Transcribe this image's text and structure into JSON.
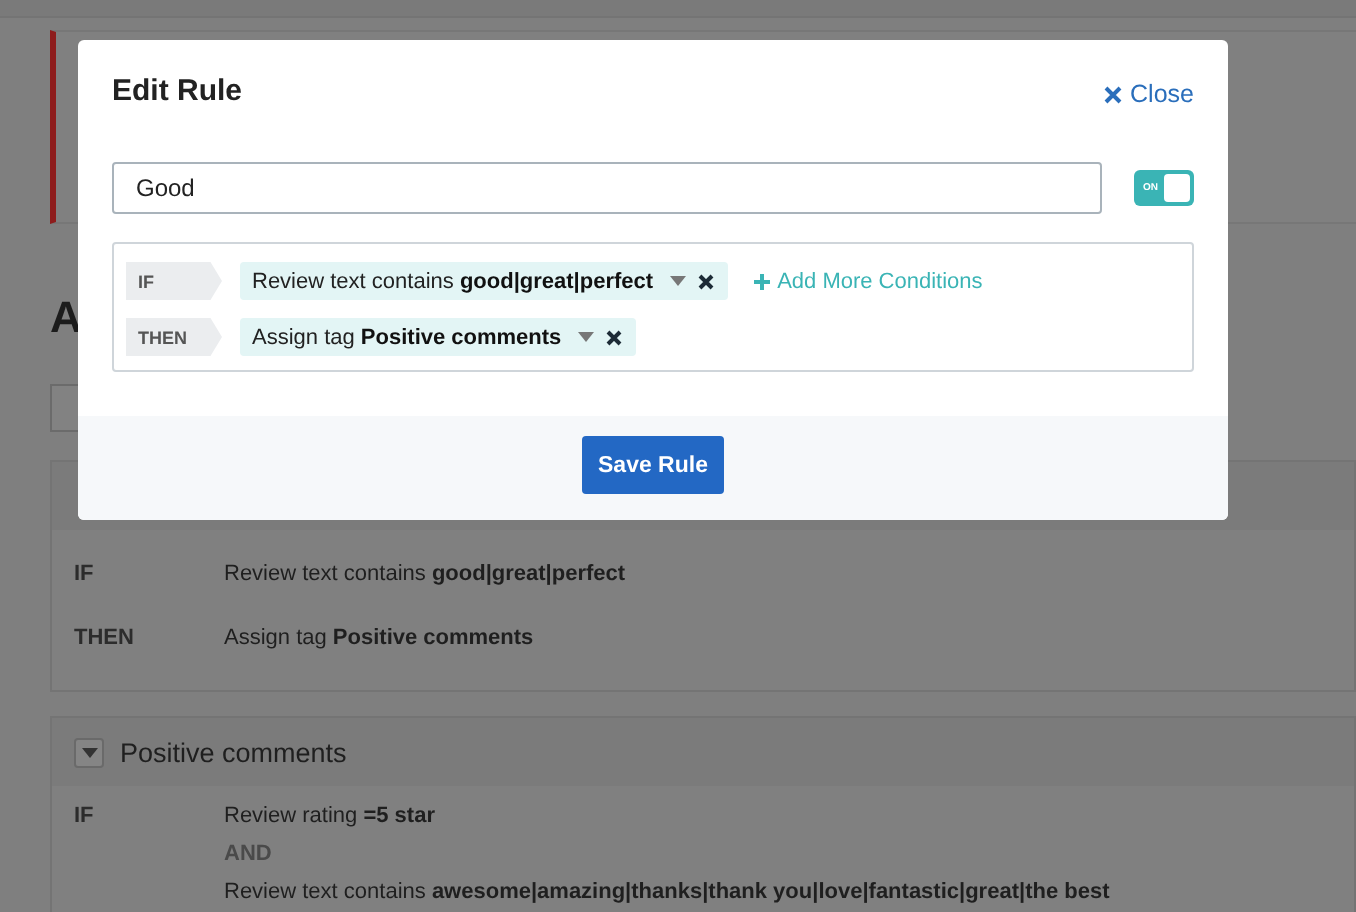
{
  "background": {
    "heading": "A",
    "rules": [
      {
        "lines": [
          {
            "kind": "clause",
            "keyword": "IF",
            "text": "Review text contains **good|great|perfect**"
          },
          {
            "kind": "clause",
            "keyword": "THEN",
            "text": "Assign tag **Positive comments**"
          }
        ]
      },
      {
        "title": "Positive comments",
        "expanded": true,
        "lines": [
          {
            "kind": "clause",
            "keyword": "IF",
            "text": "Review rating **=5 star**"
          },
          {
            "kind": "joiner",
            "text": "AND"
          },
          {
            "kind": "clause",
            "text": "Review text contains **awesome|amazing|thanks|thank you|love|fantastic|great|the best**"
          }
        ]
      }
    ]
  },
  "modal": {
    "title": "Edit Rule",
    "close": "Close",
    "name_value": "Good",
    "enabled": true,
    "toggle_label": "ON",
    "conditions": [
      {
        "keyword": "IF",
        "text": "Review text contains **good|great|perfect**",
        "add_more": "Add More Conditions"
      },
      {
        "keyword": "THEN",
        "text": "Assign tag **Positive comments**"
      }
    ],
    "save": "Save Rule"
  }
}
